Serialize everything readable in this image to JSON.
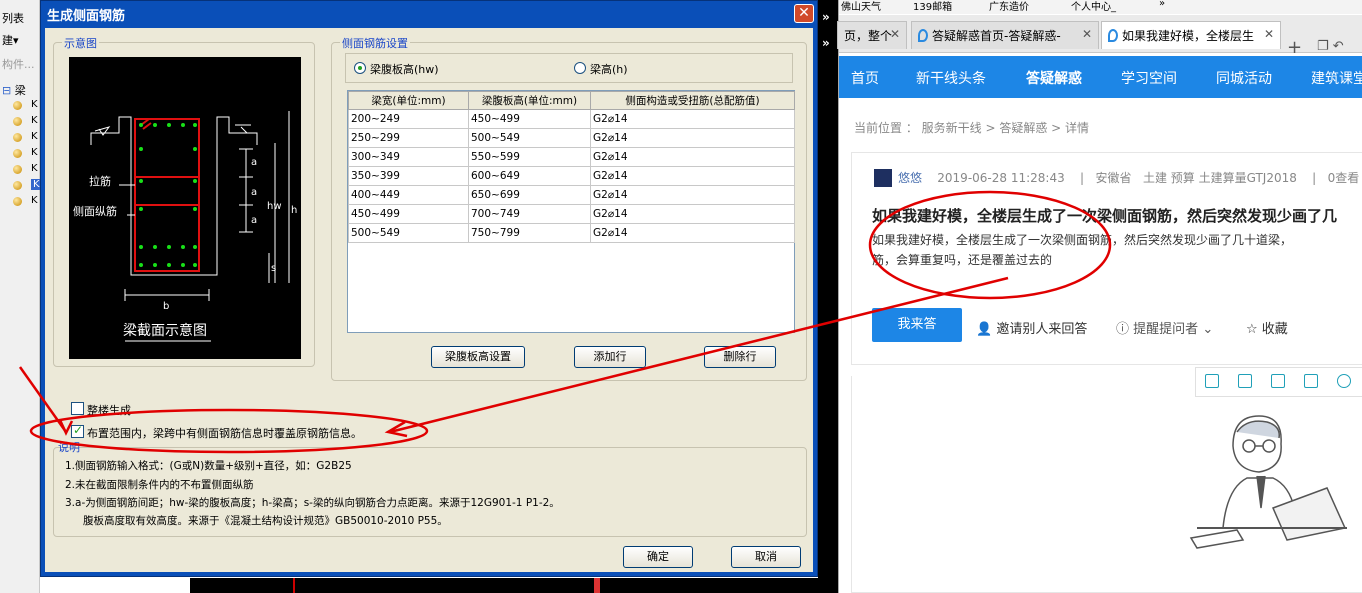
{
  "host": {
    "top_label": "列表",
    "create_label": "建▾",
    "search_placeholder": "构件...",
    "tree_root": "梁",
    "tree_items": [
      "K",
      "K",
      "K",
      "K",
      "K",
      "K",
      "K"
    ]
  },
  "dialog": {
    "title": "生成侧面钢筋",
    "close": "✕",
    "schematic_group": "示意图",
    "schematic": {
      "caption": "梁截面示意图",
      "label_tie": "拉筋",
      "label_side_bar": "侧面纵筋",
      "dim_a": "a",
      "dim_hw": "hw",
      "dim_h": "h",
      "dim_s": "s",
      "dim_b": "b"
    },
    "settings_group": "侧面钢筋设置",
    "radio_hw": "梁腹板高(hw)",
    "radio_h": "梁高(h)",
    "table": {
      "headers": [
        "梁宽(单位:mm)",
        "梁腹板高(单位:mm)",
        "侧面构造或受扭筋(总配筋值)"
      ],
      "rows": [
        [
          "200~249",
          "450~499",
          "G2⌀14"
        ],
        [
          "250~299",
          "500~549",
          "G2⌀14"
        ],
        [
          "300~349",
          "550~599",
          "G2⌀14"
        ],
        [
          "350~399",
          "600~649",
          "G2⌀14"
        ],
        [
          "400~449",
          "650~699",
          "G2⌀14"
        ],
        [
          "450~499",
          "700~749",
          "G2⌀14"
        ],
        [
          "500~549",
          "750~799",
          "G2⌀14"
        ]
      ]
    },
    "btn_web_height": "梁腹板高设置",
    "btn_add_row": "添加行",
    "btn_delete_row": "删除行",
    "chk_whole_building": "整楼生成",
    "chk_overwrite": "布置范围内，梁跨中有侧面钢筋信息时覆盖原钢筋信息。",
    "notes_label": "说明",
    "notes": [
      "1.侧面钢筋输入格式：(G或N)数量+级别+直径，如：G2B25",
      "2.未在截面限制条件内的不布置侧面纵筋",
      "3.a-为侧面钢筋间距；hw-梁的腹板高度；h-梁高；s-梁的纵向钢筋合力点距离。来源于12G901-1 P1-2。",
      "腹板高度取有效高度。来源于《混凝土结构设计规范》GB50010-2010 P55。"
    ],
    "btn_ok": "确定",
    "btn_cancel": "取消"
  },
  "browser": {
    "bookmarks": [
      "佛山天气",
      "139邮箱",
      "广东造价",
      "个人中心_",
      "»"
    ],
    "tabs": [
      {
        "label": "页，整个",
        "active": false
      },
      {
        "label": "答疑解惑首页-答疑解惑-",
        "active": false
      },
      {
        "label": "如果我建好模，全楼层生",
        "active": true
      }
    ],
    "plus": "+",
    "nav": [
      "首页",
      "新干线头条",
      "答疑解惑",
      "学习空间",
      "同城活动",
      "建筑课堂"
    ],
    "nav_current": "答疑解惑",
    "breadcrumb": "当前位置 ： 服务新干线 > 答疑解惑 > 详情",
    "question": {
      "author": "悠悠",
      "time": "2019-06-28 11:28:43",
      "province": "安徽省",
      "tags": "土建 预算 土建算量GTJ2018",
      "views": "0查看",
      "title": "如果我建好模，全楼层生成了一次梁侧面钢筋，然后突然发现少画了几",
      "body_line1": "如果我建好模，全楼层生成了一次梁侧面钢筋，然后突然发现少画了几十道梁，",
      "body_line2": "筋，会算重复吗，还是覆盖过去的"
    },
    "answer_btn": "我来答",
    "invite": "邀请别人来回答",
    "remind": "提醒提问者",
    "collect": "收藏"
  },
  "colors": {
    "dialog_title_bar": "#0a4fb8",
    "dialog_bg": "#ece9d8",
    "browser_nav": "#1d86e6",
    "annotation": "#e00000"
  }
}
